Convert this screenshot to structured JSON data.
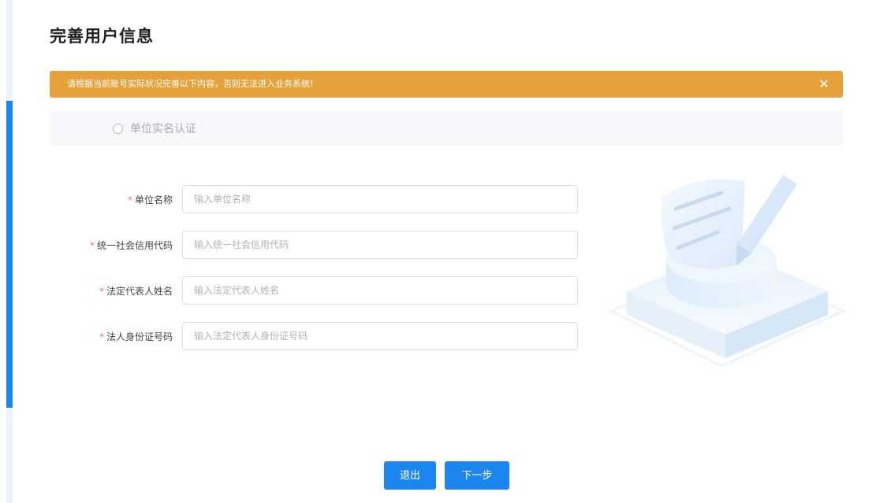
{
  "page": {
    "title": "完善用户信息"
  },
  "alert": {
    "message": "请根据当前账号实际状况完善以下内容，否则无法进入业务系统!",
    "close_icon": "close-icon",
    "color": "#e5a23c"
  },
  "steps": [
    {
      "label": "单位实名认证",
      "active": false
    }
  ],
  "side_progress": {
    "color": "#1c86ee"
  },
  "form": {
    "required_mark": "*",
    "fields": [
      {
        "label": "单位名称",
        "placeholder": "输入单位名称",
        "value": ""
      },
      {
        "label": "统一社会信用代码",
        "placeholder": "输入统一社会信用代码",
        "value": ""
      },
      {
        "label": "法定代表人姓名",
        "placeholder": "输入法定代表人姓名",
        "value": ""
      },
      {
        "label": "法人身份证号码",
        "placeholder": "输入法定代表人身份证号码",
        "value": ""
      }
    ]
  },
  "buttons": {
    "exit": "退出",
    "next": "下一步",
    "primary_color": "#1c86ee"
  }
}
